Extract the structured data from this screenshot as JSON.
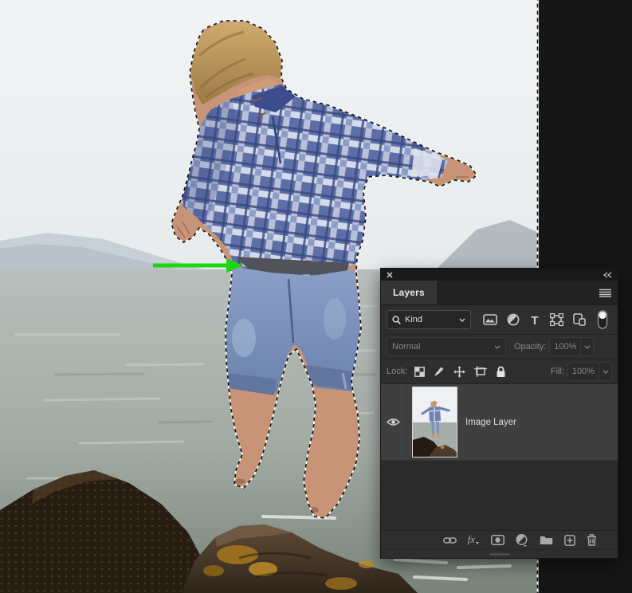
{
  "panel": {
    "tabs": [
      {
        "label": "Layers",
        "active": true
      }
    ],
    "header_icons": [
      "close-icon",
      "collapse-panel-icon",
      "panel-menu-icon"
    ],
    "filter_bar": {
      "search_dropdown": {
        "label": "Kind",
        "icon": "search-icon"
      },
      "type_filters": [
        "pixel-layer-filter-icon",
        "adjustment-layer-filter-icon",
        "type-layer-filter-icon",
        "shape-layer-filter-icon",
        "smart-object-filter-icon"
      ],
      "toggle": "layer-filter-switch"
    },
    "blend_bar": {
      "blend_mode": "Normal",
      "opacity_label": "Opacity:",
      "opacity_value": "100%"
    },
    "lock_bar": {
      "label": "Lock:",
      "icons": [
        "lock-transparency-icon",
        "lock-paint-icon",
        "lock-move-icon",
        "lock-artboard-icon",
        "lock-all-icon"
      ],
      "fill_label": "Fill:",
      "fill_value": "100%"
    },
    "layers": [
      {
        "name": "Image Layer",
        "visible": true,
        "selected": true
      }
    ],
    "footer_icons": [
      "link-layers-icon",
      "layer-effects-icon",
      "layer-mask-icon",
      "adjustment-layer-icon",
      "layer-group-icon",
      "new-layer-icon",
      "delete-layer-icon"
    ]
  },
  "annotation": {
    "arrow": {
      "direction": "right",
      "color": "#1fd412"
    }
  },
  "canvas": {
    "selection": "marching ants around jumping subject and along right canvas edge"
  },
  "colors": {
    "workspace_bg": "#161616",
    "panel_bg": "#2e2e2e",
    "selected_row": "#3f3f3f",
    "accent_green": "#1fd412",
    "sky": "#eff1f2",
    "sea": "#a8afab",
    "rock_dark": "#261b12",
    "rock_brown": "#4a3a2c",
    "lichen": "#b58427",
    "shirt_blue": "#5d6fa6",
    "jeans_blue": "#7d94bc",
    "skin": "#c89478",
    "hair": "#c4a065"
  }
}
